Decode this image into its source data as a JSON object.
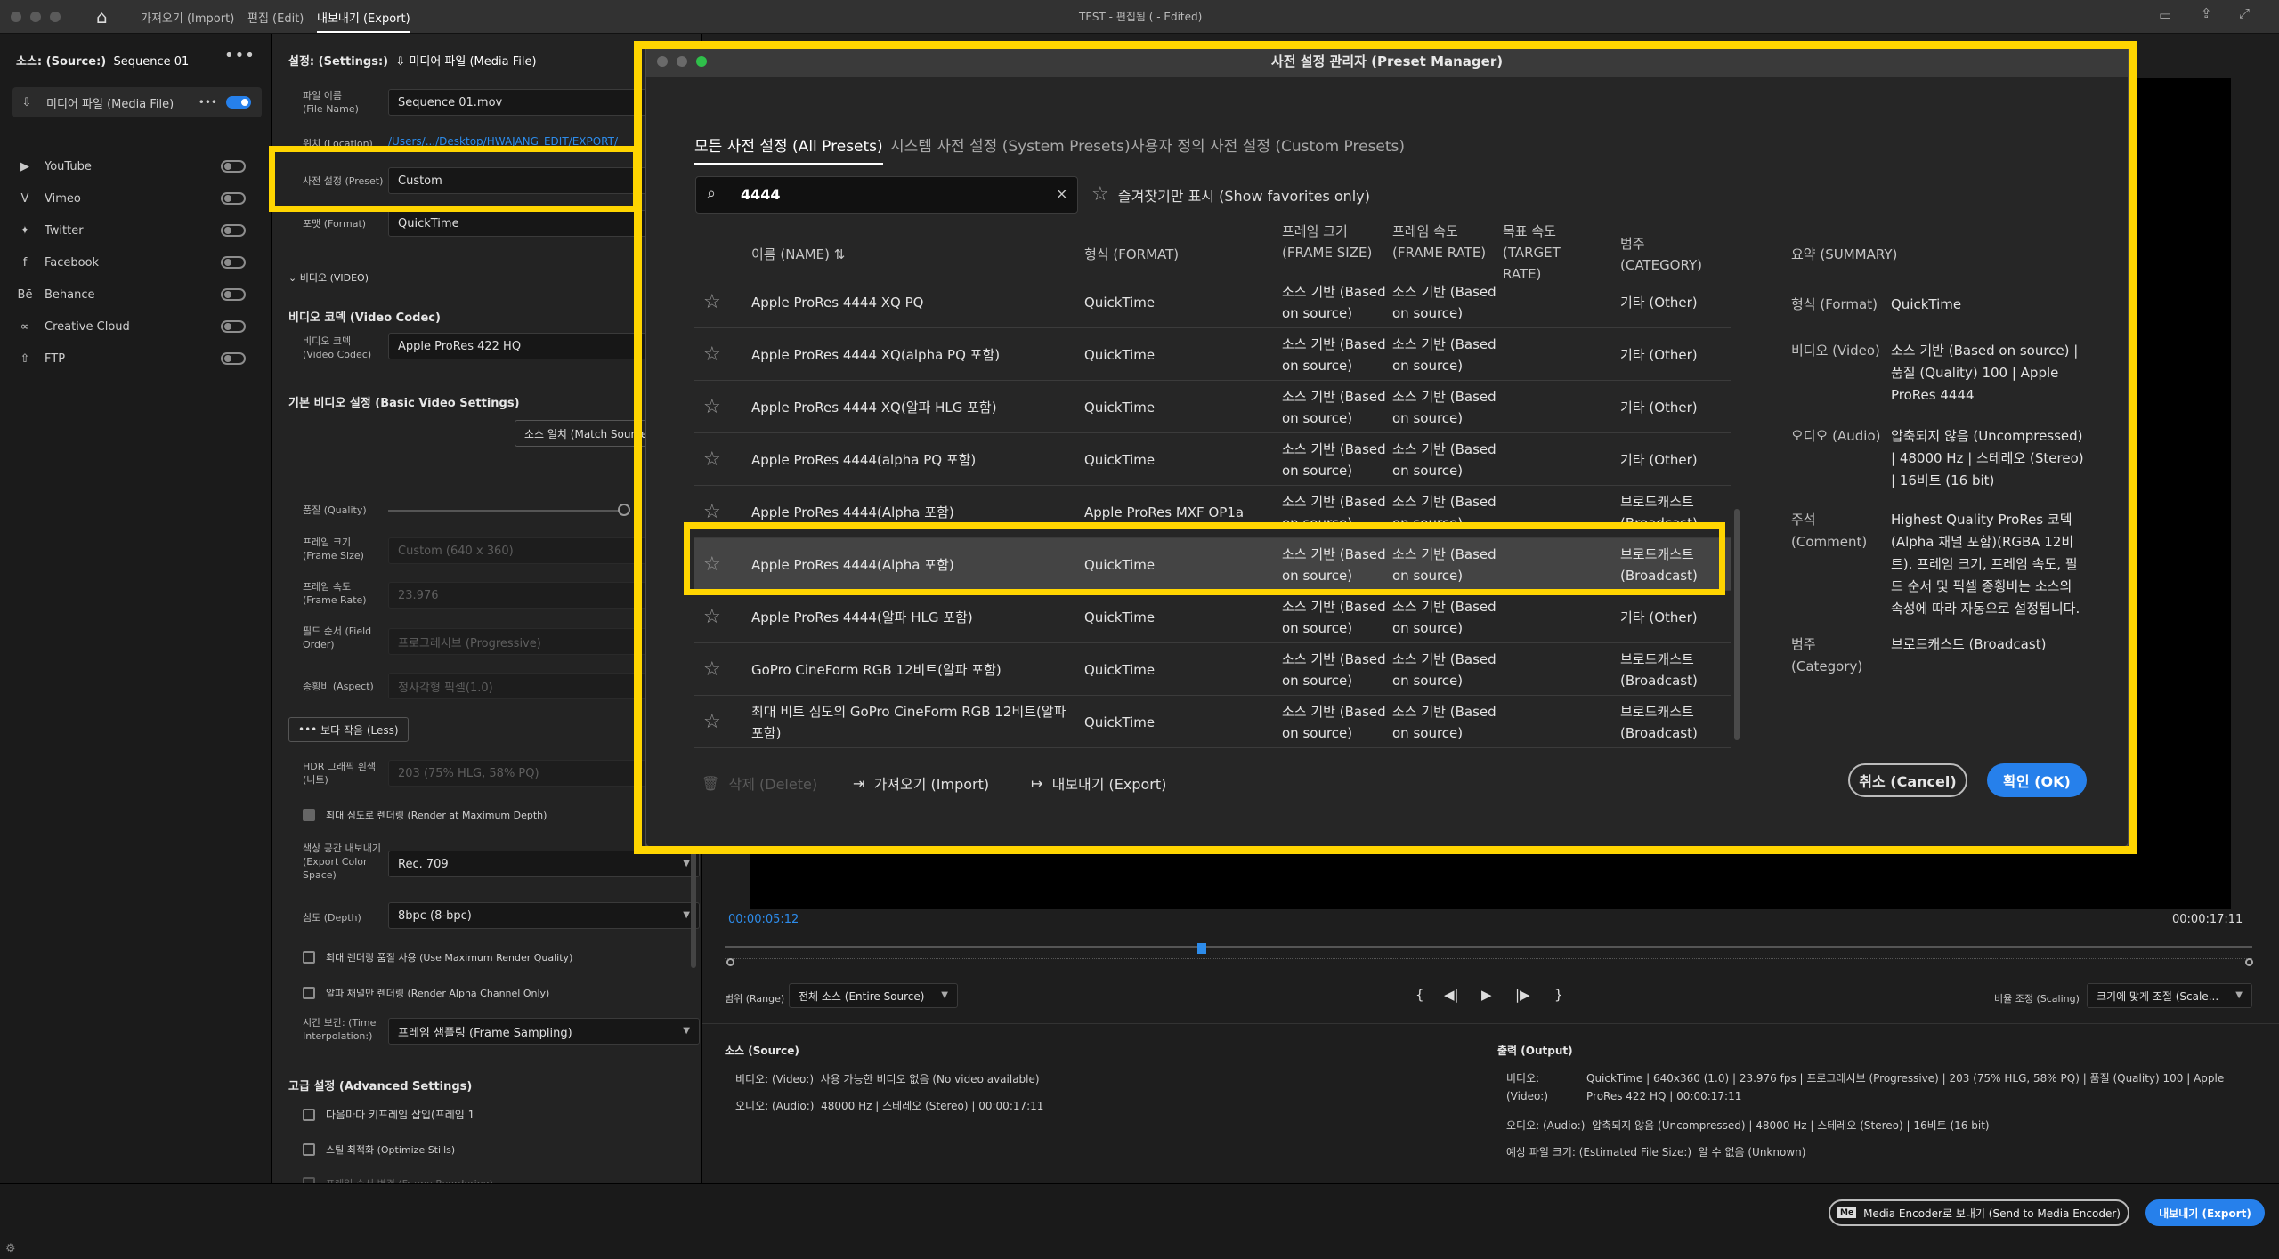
{
  "topbar": {
    "tabs": [
      "가져오기 (Import)",
      "편집 (Edit)",
      "내보내기 (Export)"
    ],
    "title": "TEST - 편집됨 ( - Edited)"
  },
  "source": {
    "label": "소스: (Source:)",
    "sequence": "Sequence 01",
    "destinations": [
      {
        "label": "미디어 파일 (Media File)",
        "icon": "export-icon",
        "on": true
      },
      {
        "label": "YouTube",
        "icon": "youtube-icon",
        "on": false
      },
      {
        "label": "Vimeo",
        "icon": "vimeo-icon",
        "on": false
      },
      {
        "label": "Twitter",
        "icon": "twitter-icon",
        "on": false
      },
      {
        "label": "Facebook",
        "icon": "facebook-icon",
        "on": false
      },
      {
        "label": "Behance",
        "icon": "behance-icon",
        "on": false
      },
      {
        "label": "Creative Cloud",
        "icon": "creative-cloud-icon",
        "on": false
      },
      {
        "label": "FTP",
        "icon": "upload-icon",
        "on": false
      }
    ]
  },
  "settings": {
    "header": "설정: (Settings:)",
    "media_file": "미디어 파일 (Media File)",
    "file_name_label": "파일 이름 (File Name)",
    "file_name_value": "Sequence 01.mov",
    "location_label": "위치 (Location)",
    "location_value": "/Users/.../Desktop/HWAJANG_EDIT/EXPORT/",
    "preset_label": "사전 설정 (Preset)",
    "preset_value": "Custom",
    "format_label": "포맷 (Format)",
    "format_value": "QuickTime",
    "video_section": "비디오 (VIDEO)",
    "video_codec_section": "비디오 코덱 (Video Codec)",
    "video_codec_label": "비디오 코덱 (Video Codec)",
    "video_codec_value": "Apple ProRes 422 HQ",
    "basic_video_section": "기본 비디오 설정 (Basic Video Settings)",
    "match_source": "소스 일치 (Match Source)",
    "quality_label": "품질 (Quality)",
    "quality_level": 100,
    "frame_size_label": "프레임 크기 (Frame Size)",
    "frame_size_value": "Custom (640 x 360)",
    "frame_rate_label": "프레임 속도 (Frame Rate)",
    "frame_rate_value": "23.976",
    "field_order_label": "필드 순서 (Field Order)",
    "field_order_value": "프로그레시브 (Progressive)",
    "aspect_label": "종횡비 (Aspect)",
    "aspect_value": "정사각형 픽셀(1.0)",
    "less_button": "보다 작음 (Less)",
    "hdr_label": "HDR 그래픽 흰색 (니트)",
    "hdr_value": "203 (75% HLG, 58% PQ)",
    "render_max_depth": "최대 심도로 렌더링 (Render at Maximum Depth)",
    "export_color_label": "색상 공간 내보내기 (Export Color Space)",
    "export_color_value": "Rec. 709",
    "depth_label": "심도 (Depth)",
    "depth_value": "8bpc (8-bpc)",
    "max_render_quality": "최대 렌더링 품질 사용 (Use Maximum Render Quality)",
    "render_alpha": "알파 채널만 렌더링 (Render Alpha Channel Only)",
    "time_interp_label": "시간 보간: (Time Interpolation:)",
    "time_interp_value": "프레임 샘플링 (Frame Sampling)",
    "advanced_section": "고급 설정 (Advanced Settings)",
    "keyframe_insert": "다음마다 키프레임 삽입(프레임 1",
    "optimize_stills": "스틸 최적화 (Optimize Stills)",
    "frame_reorder": "프레임 순서 변경 (Frame Reordering)"
  },
  "dialog": {
    "title": "사전 설정 관리자 (Preset Manager)",
    "tabs": [
      "모든 사전 설정 (All Presets)",
      "시스템 사전 설정 (System Presets)",
      "사용자 정의 사전 설정 (Custom Presets)"
    ],
    "search_value": "4444",
    "favorites_label": "즐겨찾기만 표시 (Show favorites only)",
    "columns": {
      "name": "이름 (NAME)",
      "format": "형식 (FORMAT)",
      "frame_size": "프레임 크기 (FRAME SIZE)",
      "frame_rate": "프레임 속도 (FRAME RATE)",
      "target_rate": "목표 속도 (TARGET RATE)",
      "category": "범주 (CATEGORY)"
    },
    "rows": [
      {
        "name": "Apple ProRes 4444 XQ PQ",
        "format": "QuickTime",
        "size": "소스 기반 (Based on source)",
        "rate": "소스 기반 (Based on source)",
        "category": "기타 (Other)"
      },
      {
        "name": "Apple ProRes 4444 XQ(alpha PQ 포함)",
        "format": "QuickTime",
        "size": "소스 기반 (Based on source)",
        "rate": "소스 기반 (Based on source)",
        "category": "기타 (Other)"
      },
      {
        "name": "Apple ProRes 4444 XQ(알파 HLG 포함)",
        "format": "QuickTime",
        "size": "소스 기반 (Based on source)",
        "rate": "소스 기반 (Based on source)",
        "category": "기타 (Other)"
      },
      {
        "name": "Apple ProRes 4444(alpha PQ 포함)",
        "format": "QuickTime",
        "size": "소스 기반 (Based on source)",
        "rate": "소스 기반 (Based on source)",
        "category": "기타 (Other)"
      },
      {
        "name": "Apple ProRes 4444(Alpha 포함)",
        "format": "Apple ProRes MXF OP1a",
        "size": "소스 기반 (Based on source)",
        "rate": "소스 기반 (Based on source)",
        "category": "브로드캐스트 (Broadcast)"
      },
      {
        "name": "Apple ProRes 4444(Alpha 포함)",
        "format": "QuickTime",
        "size": "소스 기반 (Based on source)",
        "rate": "소스 기반 (Based on source)",
        "category": "브로드캐스트 (Broadcast)"
      },
      {
        "name": "Apple ProRes 4444(알파 HLG 포함)",
        "format": "QuickTime",
        "size": "소스 기반 (Based on source)",
        "rate": "소스 기반 (Based on source)",
        "category": "기타 (Other)"
      },
      {
        "name": "GoPro CineForm RGB 12비트(알파 포함)",
        "format": "QuickTime",
        "size": "소스 기반 (Based on source)",
        "rate": "소스 기반 (Based on source)",
        "category": "브로드캐스트 (Broadcast)"
      },
      {
        "name": "최대 비트 심도의 GoPro CineForm RGB 12비트(알파 포함)",
        "format": "QuickTime",
        "size": "소스 기반 (Based on source)",
        "rate": "소스 기반 (Based on source)",
        "category": "브로드캐스트 (Broadcast)"
      }
    ],
    "selected_index": 5,
    "summary": {
      "header": "요약 (SUMMARY)",
      "format_label": "형식 (Format)",
      "format_value": "QuickTime",
      "video_label": "비디오 (Video)",
      "video_value": "소스 기반 (Based on source) | 품질 (Quality) 100 | Apple ProRes 4444",
      "audio_label": "오디오 (Audio)",
      "audio_value": "압축되지 않음 (Uncompressed) | 48000 Hz | 스테레오 (Stereo) | 16비트 (16 bit)",
      "comment_label": "주석 (Comment)",
      "comment_value": "Highest Quality ProRes 코덱 (Alpha 채널 포함)(RGBA 12비트). 프레임 크기, 프레임 속도, 필드 순서 및 픽셀 종횡비는 소스의 속성에 따라 자동으로 설정됩니다.",
      "category_label": "범주 (Category)",
      "category_value": "브로드캐스트 (Broadcast)"
    },
    "delete_button": "삭제 (Delete)",
    "import_button": "가져오기 (Import)",
    "export_button": "내보내기 (Export)",
    "cancel_button": "취소 (Cancel)",
    "ok_button": "확인 (OK)"
  },
  "preview": {
    "timecode_current": "00:00:05:12",
    "timecode_end": "00:00:17:11",
    "range_label": "범위 (Range)",
    "range_value": "전체 소스 (Entire Source)",
    "scaling_label": "비율 조정 (Scaling)",
    "scaling_value": "크기에 맞게 조절 (Scale..."
  },
  "source_info": {
    "header": "소스 (Source)",
    "video_label": "비디오: (Video:)",
    "video_value": "사용 가능한 비디오 없음 (No video available)",
    "audio_label": "오디오: (Audio:)",
    "audio_value": "48000 Hz | 스테레오 (Stereo) | 00:00:17:11"
  },
  "output_info": {
    "header": "출력 (Output)",
    "video_label": "비디오: (Video:)",
    "video_value": "QuickTime | 640x360 (1.0) | 23.976 fps | 프로그레시브 (Progressive) | 203 (75% HLG, 58% PQ) | 품질 (Quality) 100 | Apple ProRes 422 HQ | 00:00:17:11",
    "audio_label": "오디오: (Audio:)",
    "audio_value": "압축되지 않음 (Uncompressed) | 48000 Hz | 스테레오 (Stereo) | 16비트 (16 bit)",
    "size_label": "예상 파일 크기: (Estimated File Size:)",
    "size_value": "알 수 없음 (Unknown)"
  },
  "footer": {
    "media_encoder_button": "Media Encoder로 보내기 (Send to Media Encoder)",
    "export_button": "내보내기 (Export)"
  },
  "colors": {
    "accent": "#2680eb",
    "highlight": "#ffd500"
  }
}
